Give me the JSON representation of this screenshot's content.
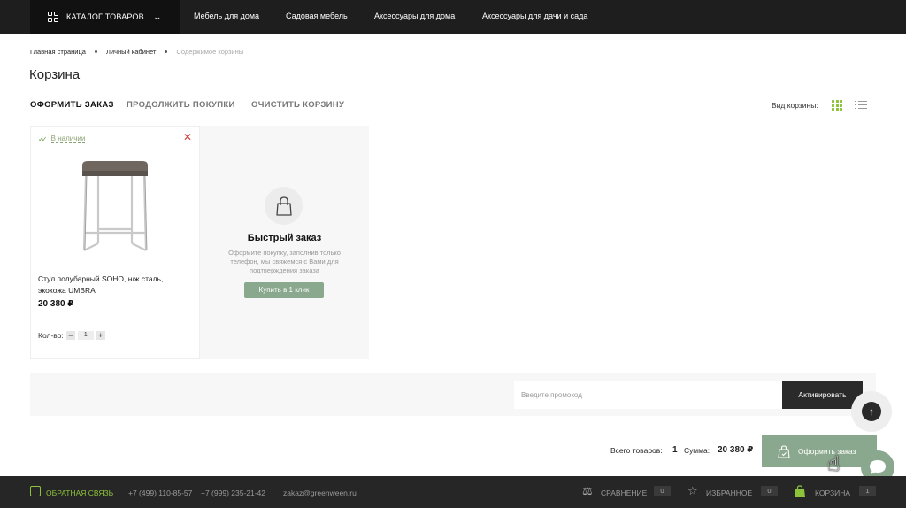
{
  "header": {
    "catalog_label": "КАТАЛОГ ТОВАРОВ",
    "nav": [
      "Мебель для дома",
      "Садовая мебель",
      "Аксессуары для дома",
      "Аксессуары для дачи и сада"
    ]
  },
  "breadcrumb": [
    "Главная страница",
    "Личный кабинет",
    "Содержимое корзины"
  ],
  "page_title": "Корзина",
  "actions": {
    "checkout": "ОФОРМИТЬ ЗАКАЗ",
    "continue": "ПРОДОЛЖИТЬ ПОКУПКИ",
    "clear": "ОЧИСТИТЬ КОРЗИНУ"
  },
  "view": {
    "label": "Вид корзины:",
    "active": "grid"
  },
  "product": {
    "stock": "В наличии",
    "name": "Стул полубарный SOHO, н/ж сталь, экокожа UMBRA",
    "price": "20 380 ₽",
    "qty_label": "Кол-во:",
    "qty": "1",
    "minus": "−",
    "plus": "+"
  },
  "quick_order": {
    "title": "Быстрый заказ",
    "description": "Оформите покупку, заполнив только телефон, мы свяжемся с Вами для подтверждения заказа",
    "button": "Купить в 1 клик"
  },
  "promo": {
    "placeholder": "Введите промокод",
    "value": "",
    "button": "Активировать"
  },
  "totals": {
    "items_label": "Всего товаров:",
    "items_count": "1",
    "sum_label": "Сумма:",
    "sum": "20 380 ₽",
    "checkout_button": "Оформить заказ"
  },
  "footer": {
    "feedback": "ОБРАТНАЯ СВЯЗЬ",
    "phone1": "+7 (499) 110-85-57",
    "phone2": "+7 (999) 235-21-42",
    "email": "zakaz@greenween.ru",
    "compare_label": "СРАВНЕНИЕ",
    "compare_count": "0",
    "favorites_label": "ИЗБРАННОЕ",
    "favorites_count": "0",
    "cart_label": "КОРЗИНА",
    "cart_count": "1"
  },
  "colors": {
    "accent_green": "#8aa88d",
    "brand_lime": "#8dc33a",
    "remove_red": "#d43b3b",
    "dark": "#1e1e1e"
  }
}
